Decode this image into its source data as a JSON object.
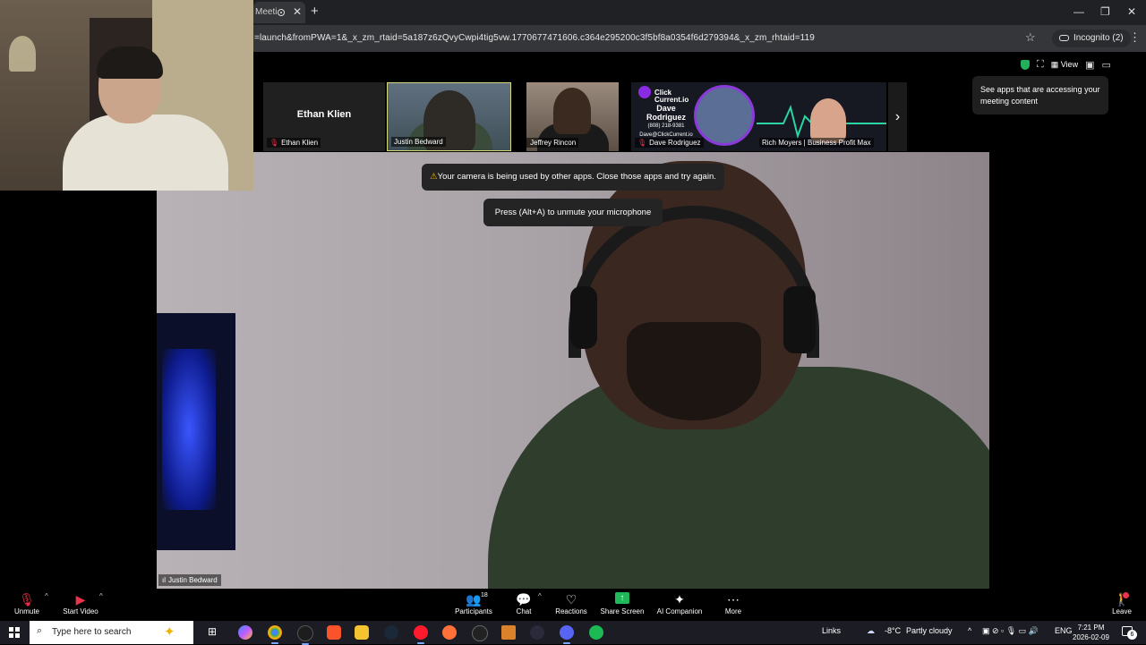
{
  "browser": {
    "tab_title": "Meeti",
    "new_tab": "+",
    "window_controls": {
      "minimize": "—",
      "restore": "❐",
      "close": "✕"
    },
    "url": "=launch&fromPWA=1&_x_zm_rtaid=5a187z6zQvyCwpi4tig5vw.1770677471606.c364e295200c3f5bf8a0354f6d279394&_x_zm_rhtaid=119",
    "incognito_label": "Incognito (2)"
  },
  "zoom": {
    "view_label": "View",
    "tooltip": "See apps that are accessing your meeting content",
    "tiles": [
      {
        "name": "Ethan Klien",
        "center_name": "Ethan Klien",
        "muted": true
      },
      {
        "name": "Justin Bedward",
        "muted": false
      },
      {
        "name": "Jeffrey Rincon",
        "muted": true
      },
      {
        "name": "Dave Rodriguez",
        "muted": true
      },
      {
        "name": "Rich Moyers | Business Profit Max",
        "muted": false
      }
    ],
    "dave_card": {
      "logo_line1": "Click",
      "logo_line2": "Current.io",
      "name_line1": "Dave",
      "name_line2": "Rodriguez",
      "phone": "(808) 218-9381",
      "email": "Dave@ClickCurrent.io"
    },
    "next_arrow": "›",
    "main_speaker": "Justin Bedward",
    "camera_warning": "Your camera is being used by other apps. Close those apps and try again.",
    "unmute_hint": "Press (Alt+A) to unmute your microphone",
    "toolbar": {
      "unmute": "Unmute",
      "start_video": "Start Video",
      "participants": "Participants",
      "participants_count": "18",
      "chat": "Chat",
      "reactions": "Reactions",
      "share_screen": "Share Screen",
      "ai_companion": "AI Companion",
      "more": "More",
      "leave": "Leave"
    }
  },
  "taskbar": {
    "search_placeholder": "Type here to search",
    "links": "Links",
    "weather_temp": "-8°C",
    "weather_text": "Partly cloudy",
    "language": "ENG",
    "time": "7:21 PM",
    "date": "2026-02-09",
    "notification_count": "6"
  },
  "colors": {
    "accent_green": "#1fb85a",
    "mute_red": "#e8344c",
    "active_tile_border": "#d6d87a",
    "warning": "#f0b000"
  }
}
